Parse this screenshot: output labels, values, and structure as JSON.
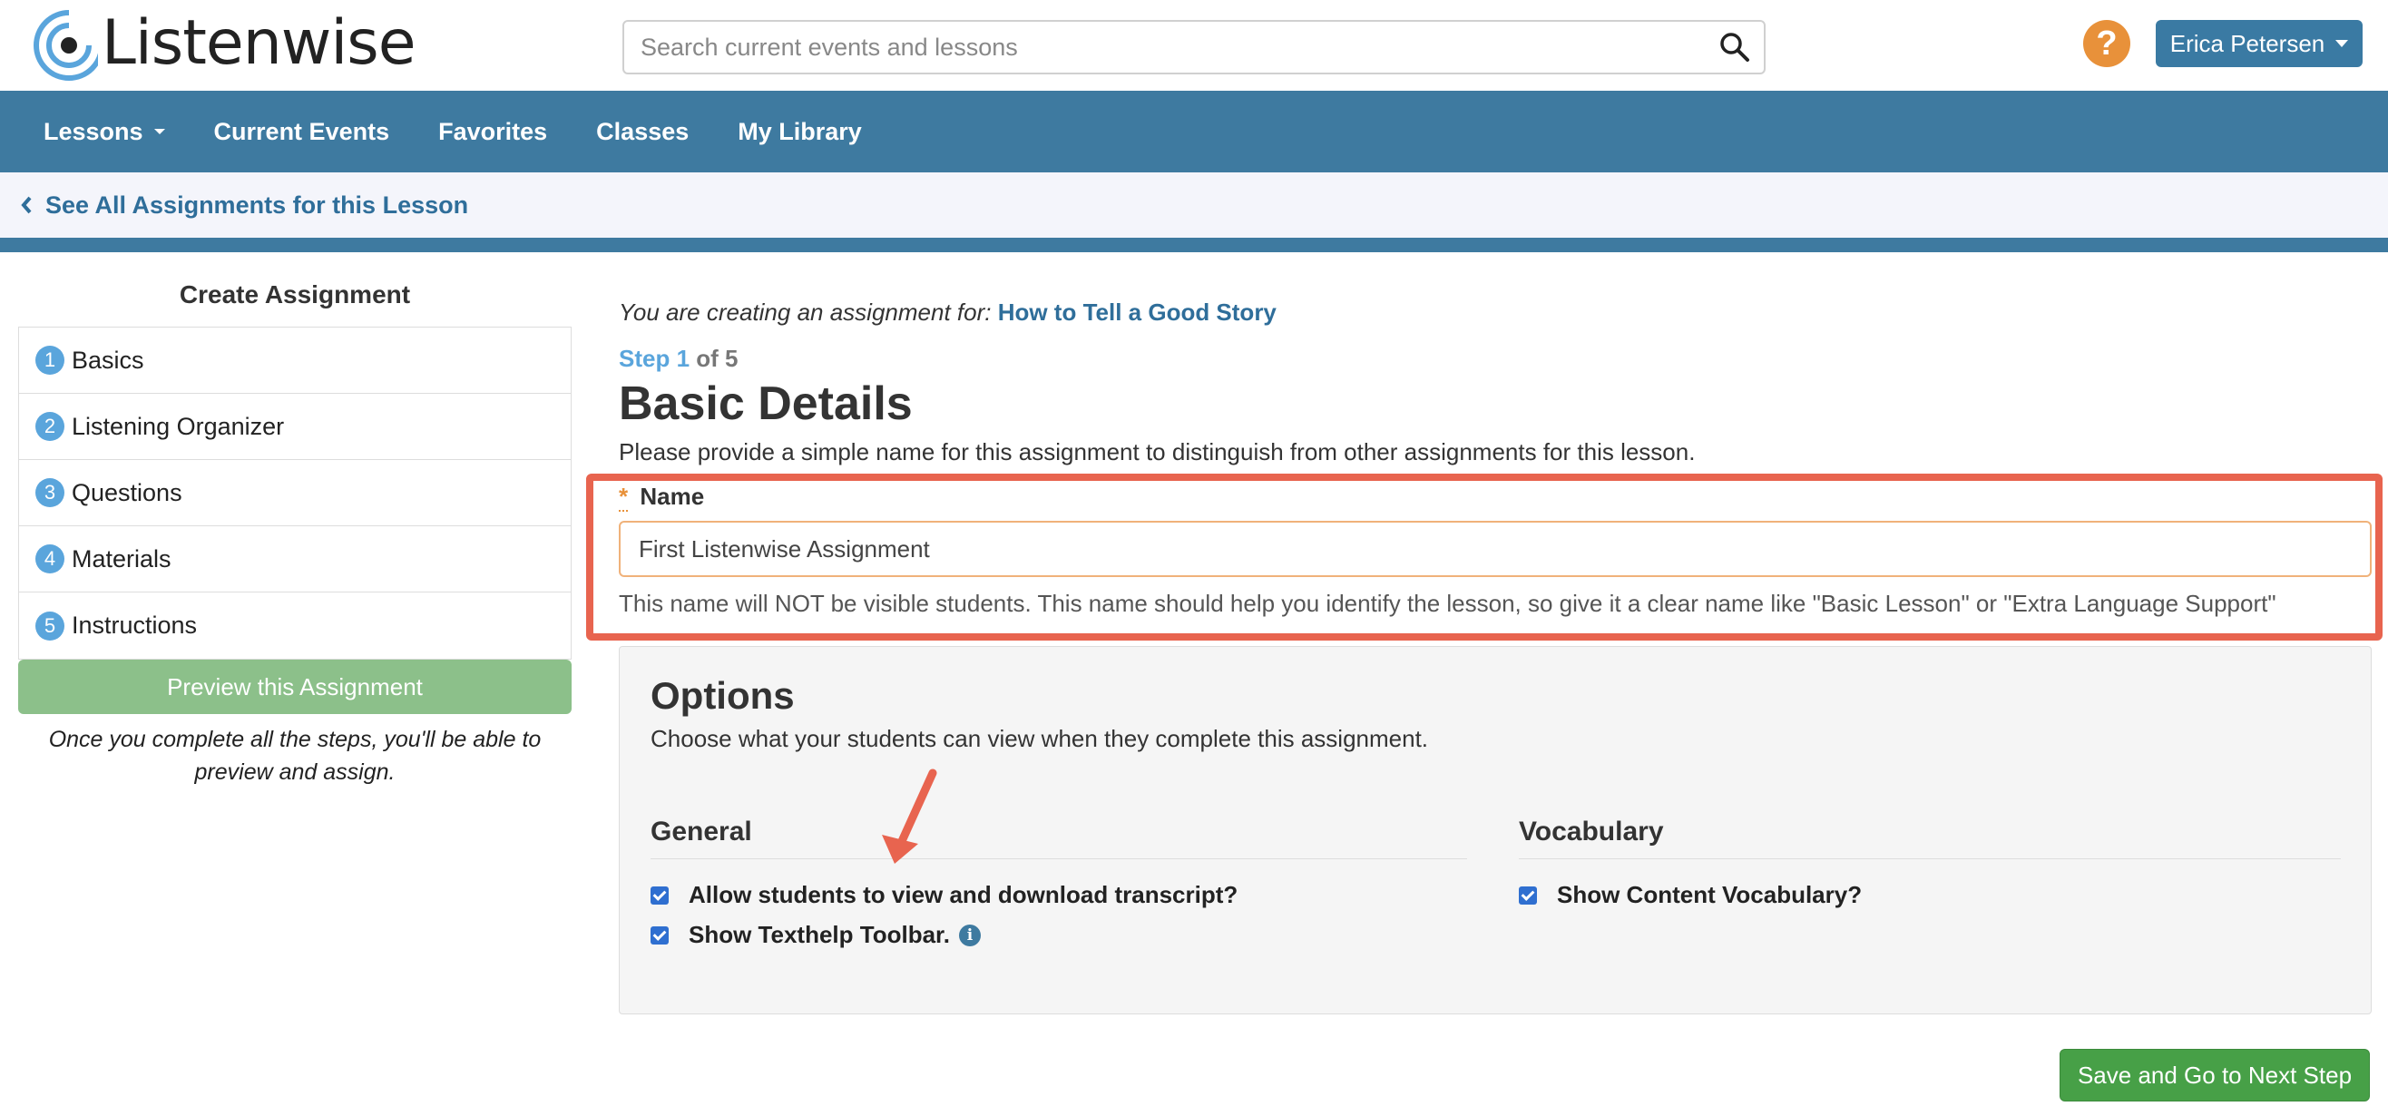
{
  "header": {
    "logo_text": "Listenwise",
    "search_placeholder": "Search current events and lessons",
    "help_label": "?",
    "user_name": "Erica Petersen"
  },
  "nav": {
    "items": [
      {
        "label": "Lessons"
      },
      {
        "label": "Current Events"
      },
      {
        "label": "Favorites"
      },
      {
        "label": "Classes"
      },
      {
        "label": "My Library"
      }
    ]
  },
  "back_link": "See All Assignments for this Lesson",
  "sidebar": {
    "title": "Create Assignment",
    "steps": [
      {
        "num": "1",
        "label": "Basics"
      },
      {
        "num": "2",
        "label": "Listening Organizer"
      },
      {
        "num": "3",
        "label": "Questions"
      },
      {
        "num": "4",
        "label": "Materials"
      },
      {
        "num": "5",
        "label": "Instructions"
      }
    ],
    "preview_label": "Preview this Assignment",
    "note": "Once you complete all the steps, you'll be able to preview and assign."
  },
  "main": {
    "context_prefix": "You are creating an assignment for:",
    "lesson_title": "How to Tell a Good Story",
    "step_current": "Step 1",
    "step_total": "of 5",
    "title": "Basic Details",
    "description": "Please provide a simple name for this assignment to distinguish from other assignments for this lesson.",
    "name_field": {
      "required_mark": "*",
      "label": "Name",
      "value": "First Listenwise Assignment",
      "help": "This name will NOT be visible students. This name should help you identify the lesson, so give it a clear name like \"Basic Lesson\" or \"Extra Language Support\""
    },
    "options": {
      "title": "Options",
      "description": "Choose what your students can view when they complete this assignment.",
      "general": {
        "heading": "General",
        "items": [
          {
            "label": "Allow students to view and download transcript?",
            "checked": true
          },
          {
            "label": "Show Texthelp Toolbar.",
            "checked": true
          }
        ]
      },
      "vocabulary": {
        "heading": "Vocabulary",
        "items": [
          {
            "label": "Show Content Vocabulary?",
            "checked": true
          }
        ]
      }
    },
    "save_label": "Save and Go to Next Step"
  },
  "colors": {
    "nav_bg": "#3e7aa0",
    "link": "#2f6e9a",
    "help_orange": "#e8913a",
    "highlight_red": "#e8644f",
    "save_green": "#47a047",
    "preview_green": "#8cc08a"
  }
}
